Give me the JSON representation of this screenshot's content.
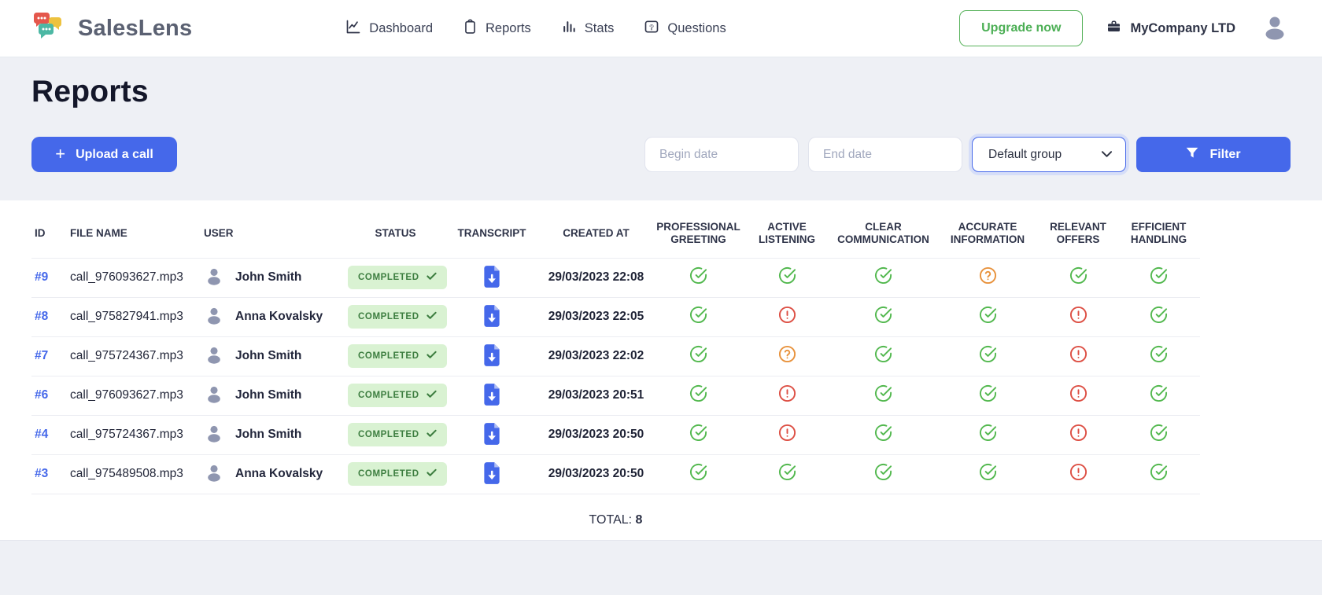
{
  "brand": {
    "name": "SalesLens"
  },
  "nav": [
    {
      "label": "Dashboard",
      "icon": "line-chart-icon"
    },
    {
      "label": "Reports",
      "icon": "clipboard-icon"
    },
    {
      "label": "Stats",
      "icon": "bar-chart-icon"
    },
    {
      "label": "Questions",
      "icon": "question-folder-icon"
    }
  ],
  "header_right": {
    "upgrade_label": "Upgrade now",
    "company_name": "MyCompany LTD",
    "company_icon": "briefcase-icon",
    "avatar_icon": "user-avatar-icon"
  },
  "page": {
    "title": "Reports"
  },
  "toolbar": {
    "upload_label": "Upload a call",
    "upload_icon": "plus-icon",
    "begin_date_placeholder": "Begin date",
    "end_date_placeholder": "End date",
    "group_select_value": "Default group",
    "filter_label": "Filter",
    "filter_icon": "funnel-icon"
  },
  "table": {
    "columns": [
      "ID",
      "FILE NAME",
      "USER",
      "STATUS",
      "TRANSCRIPT",
      "CREATED AT",
      "PROFESSIONAL GREETING",
      "ACTIVE LISTENING",
      "CLEAR COMMUNICATION",
      "ACCURATE INFORMATION",
      "RELEVANT OFFERS",
      "EFFICIENT HANDLING"
    ],
    "rows": [
      {
        "id": "#9",
        "file": "call_976093627.mp3",
        "user": "John Smith",
        "status": "COMPLETED",
        "created": "29/03/2023 22:08",
        "metrics": [
          "check",
          "check",
          "check",
          "question",
          "check",
          "check"
        ]
      },
      {
        "id": "#8",
        "file": "call_975827941.mp3",
        "user": "Anna Kovalsky",
        "status": "COMPLETED",
        "created": "29/03/2023 22:05",
        "metrics": [
          "check",
          "alert",
          "check",
          "check",
          "alert",
          "check"
        ]
      },
      {
        "id": "#7",
        "file": "call_975724367.mp3",
        "user": "John Smith",
        "status": "COMPLETED",
        "created": "29/03/2023 22:02",
        "metrics": [
          "check",
          "question",
          "check",
          "check",
          "alert",
          "check"
        ]
      },
      {
        "id": "#6",
        "file": "call_976093627.mp3",
        "user": "John Smith",
        "status": "COMPLETED",
        "created": "29/03/2023 20:51",
        "metrics": [
          "check",
          "alert",
          "check",
          "check",
          "alert",
          "check"
        ]
      },
      {
        "id": "#4",
        "file": "call_975724367.mp3",
        "user": "John Smith",
        "status": "COMPLETED",
        "created": "29/03/2023 20:50",
        "metrics": [
          "check",
          "alert",
          "check",
          "check",
          "alert",
          "check"
        ]
      },
      {
        "id": "#3",
        "file": "call_975489508.mp3",
        "user": "Anna Kovalsky",
        "status": "COMPLETED",
        "created": "29/03/2023 20:50",
        "metrics": [
          "check",
          "check",
          "check",
          "check",
          "alert",
          "check"
        ]
      }
    ],
    "total_label": "TOTAL:",
    "total_value": "8"
  },
  "colors": {
    "accent_blue": "#4568ea",
    "upgrade_green": "#57b25b",
    "metric_check_green": "#52b84e",
    "metric_question_orange": "#e8923c",
    "metric_alert_red": "#dd4f44",
    "badge_bg_green": "#d9f2d2",
    "badge_text_green": "#3c7d3f"
  }
}
